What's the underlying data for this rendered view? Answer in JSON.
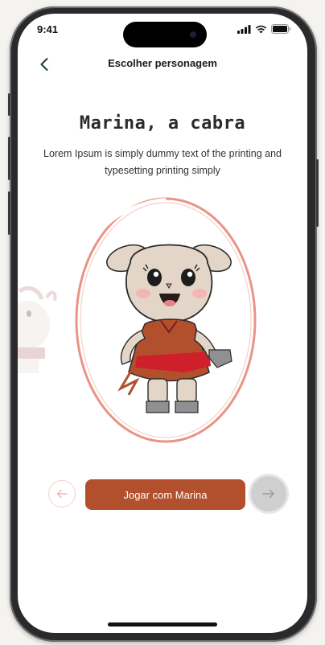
{
  "status_bar": {
    "time": "9:41"
  },
  "nav": {
    "title": "Escolher personagem",
    "back_icon": "chevron-left-icon"
  },
  "character": {
    "name": "Marina, a cabra",
    "description": "Lorem Ipsum is simply dummy text of the printing and typesetting printing simply"
  },
  "actions": {
    "prev_icon": "arrow-left-icon",
    "play_label": "Jogar com Marina",
    "next_icon": "arrow-right-icon"
  },
  "colors": {
    "accent": "#b2502d",
    "oval_ring": "#e89486",
    "dress": "#b2502d"
  }
}
